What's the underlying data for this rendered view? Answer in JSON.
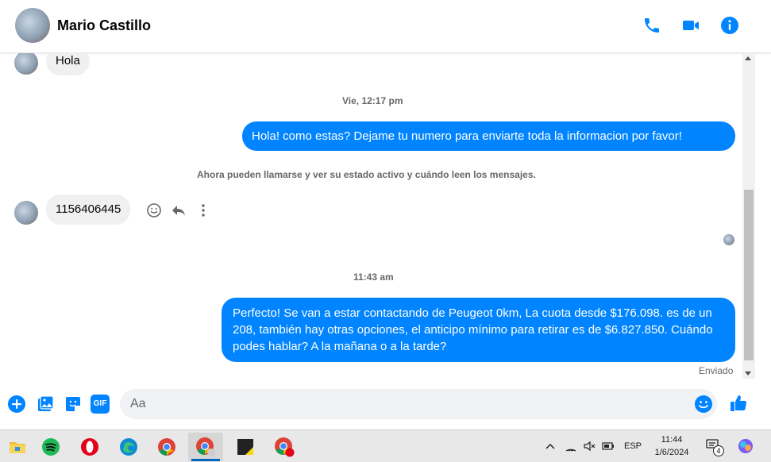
{
  "header": {
    "contact_name": "Mario Castillo",
    "icons": [
      "phone-icon",
      "video-camera-icon",
      "info-icon"
    ],
    "accent_color": "#0084ff"
  },
  "conversation": {
    "msg_hola": "Hola",
    "timestamp_1": "Vie, 12:17 pm",
    "msg_out_1": "Hola! como estas? Dejame tu numero para enviarte toda la informacion por favor!",
    "system_notice": "Ahora pueden llamarse y ver su estado activo y cuándo leen los mensajes.",
    "msg_phone": "1156406445",
    "timestamp_2": "11:43 am",
    "msg_out_2": "Perfecto!  Se van a estar contactando de Peugeot 0km, La cuota desde $176.098. es de un 208, también hay otras opciones, el anticipo mínimo para retirar es de $6.827.850. Cuándo podes hablar? A la mañana o a la tarde?",
    "status_sent": "Enviado"
  },
  "composer": {
    "placeholder": "Aa",
    "icons": [
      "plus-icon",
      "image-icon",
      "sticker-icon",
      "gif-icon",
      "emoji-icon",
      "thumbs-up-icon"
    ],
    "gif_label": "GIF"
  },
  "taskbar": {
    "apps": [
      "file-explorer-icon",
      "spotify-icon",
      "opera-icon",
      "edge-icon",
      "chrome-icon",
      "chrome-profile-icon",
      "sticky-notes-icon",
      "chrome-profile2-icon"
    ],
    "language": "ESP",
    "time": "11:44",
    "date": "1/6/2024",
    "notification_count": "4"
  }
}
